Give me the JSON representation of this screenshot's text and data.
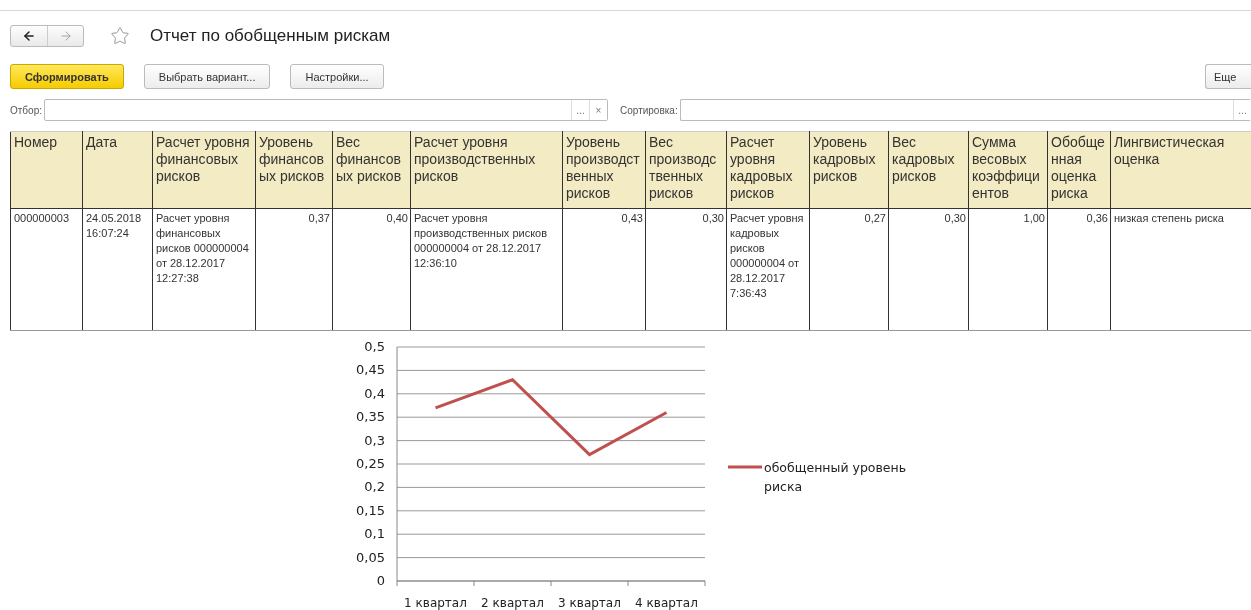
{
  "navigation": [
    {
      "kind": "back",
      "disabled": false
    },
    {
      "kind": "forward",
      "disabled": true
    }
  ],
  "title": "Отчет по обобщенным рискам",
  "favorite": false,
  "toolbar": {
    "buttons": [
      {
        "label": "Сформировать",
        "kind": "primary"
      },
      {
        "label": "Выбрать вариант...",
        "kind": "default"
      },
      {
        "label": "Настройки...",
        "kind": "default"
      }
    ],
    "more": "Еще"
  },
  "filter": {
    "label": "Отбор:",
    "select_button": "...",
    "clear_button": "×"
  },
  "sort": {
    "label": "Сортировка:",
    "select_button": "..."
  },
  "table": {
    "columns": [
      {
        "label": "Номер",
        "kind": "text"
      },
      {
        "label": "Дата",
        "kind": "text"
      },
      {
        "label": "Расчет уровня финансовых рисков",
        "kind": "text"
      },
      {
        "label": "Уровень финансовых рисков",
        "kind": "number"
      },
      {
        "label": "Вес финансовых рисков",
        "kind": "number"
      },
      {
        "label": "Расчет уровня производственных рисков",
        "kind": "text"
      },
      {
        "label": "Уровень производственных рисков",
        "kind": "number"
      },
      {
        "label": "Вес производственных рисков",
        "kind": "number"
      },
      {
        "label": "Расчет уровня кадровых рисков",
        "kind": "text"
      },
      {
        "label": "Уровень кадровых рисков",
        "kind": "number"
      },
      {
        "label": "Вес кадровых рисков",
        "kind": "number"
      },
      {
        "label": "Сумма весовых коэффициентов",
        "kind": "number"
      },
      {
        "label": "Обобщенная оценка риска",
        "kind": "number"
      },
      {
        "label": "Лингвистическая оценка",
        "kind": "text"
      }
    ],
    "rows": [
      [
        "000000003",
        "24.05.2018 16:07:24",
        "Расчет уровня финансовых рисков 000000004 от 28.12.2017 12:27:38",
        "0,37",
        "0,40",
        "Расчет уровня производственных рисков 000000004 от 28.12.2017 12:36:10",
        "0,43",
        "0,30",
        "Расчет уровня кадровых рисков 000000004 от 28.12.2017 7:36:43",
        "0,27",
        "0,30",
        "1,00",
        "0,36",
        "низкая степень риска"
      ]
    ]
  },
  "chart": {
    "chart_data": {
      "type": "line",
      "categories": [
        "1 квартал",
        "2 квартал",
        "3 квартал",
        "4 квартал"
      ],
      "series": [
        {
          "name": "обобщенный уровень риска",
          "color": "#c0504d",
          "values": [
            0.37,
            0.43,
            0.27,
            0.36
          ]
        }
      ],
      "ylim": [
        0,
        0.5
      ],
      "grid": true,
      "yticks": [
        {
          "value": 0,
          "label": "0"
        },
        {
          "value": 0.05,
          "label": "0,05"
        },
        {
          "value": 0.1,
          "label": "0,1"
        },
        {
          "value": 0.15,
          "label": "0,15"
        },
        {
          "value": 0.2,
          "label": "0,2"
        },
        {
          "value": 0.25,
          "label": "0,25"
        },
        {
          "value": 0.3,
          "label": "0,3"
        },
        {
          "value": 0.35,
          "label": "0,35"
        },
        {
          "value": 0.4,
          "label": "0,4"
        },
        {
          "value": 0.45,
          "label": "0,45"
        },
        {
          "value": 0.5,
          "label": "0,5"
        }
      ]
    }
  }
}
